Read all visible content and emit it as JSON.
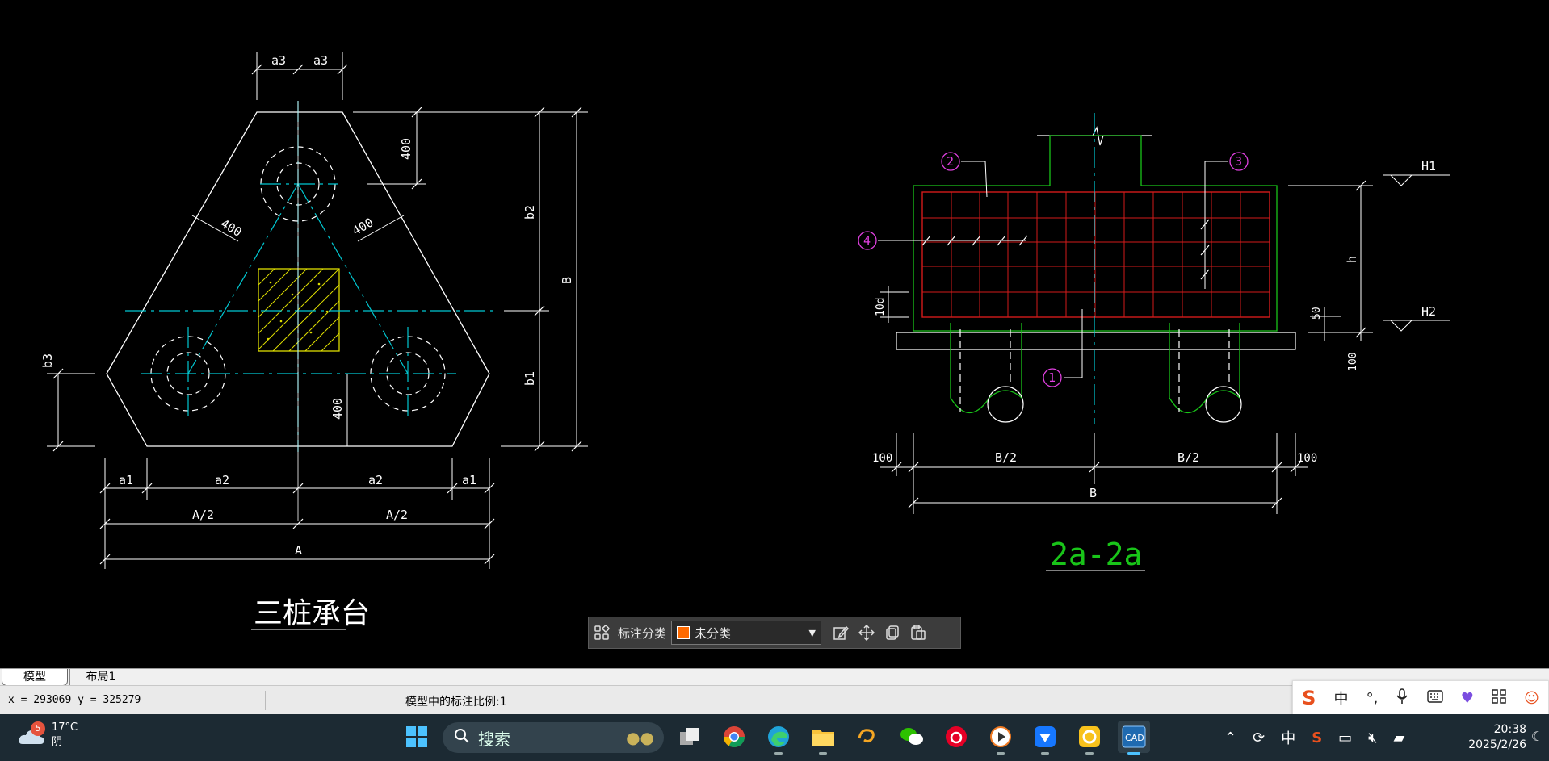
{
  "drawing": {
    "left_title": "三桩承台",
    "right_title": "2a-2a",
    "left_dims": {
      "a3_left": "a3",
      "a3_right": "a3",
      "top_400": "400",
      "side_400_left": "400",
      "side_400_right": "400",
      "bottom_400": "400",
      "b2": "b2",
      "b1": "b1",
      "B": "B",
      "b3": "b3",
      "a1_left": "a1",
      "a2_left": "a2",
      "a2_right": "a2",
      "a1_right": "a1",
      "half_left": "A/2",
      "half_right": "A/2",
      "A": "A"
    },
    "right_dims": {
      "callout_1": "1",
      "callout_2": "2",
      "callout_3": "3",
      "callout_4": "4",
      "H1": "H1",
      "H2": "H2",
      "h": "h",
      "d10": "10d",
      "fifty": "50",
      "hundred_v": "100",
      "left_100": "100",
      "right_100": "100",
      "half_left": "B/2",
      "half_right": "B/2",
      "B": "B"
    }
  },
  "annotation_toolbar": {
    "label": "标注分类",
    "selected_category": "未分类",
    "category_color": "#ff6a00"
  },
  "tabs": [
    {
      "label": "模型",
      "active": true
    },
    {
      "label": "布局1",
      "active": false
    }
  ],
  "status": {
    "coords": "x = 293069  y = 325279",
    "scale_text": "模型中的标注比例:1"
  },
  "ime": {
    "mode": "中"
  },
  "taskbar": {
    "weather_badge": "5",
    "temperature": "17°C",
    "condition": "阴",
    "search_placeholder": "搜索",
    "tray_lang": "中",
    "time": "20:38",
    "date": "2025/2/26"
  }
}
